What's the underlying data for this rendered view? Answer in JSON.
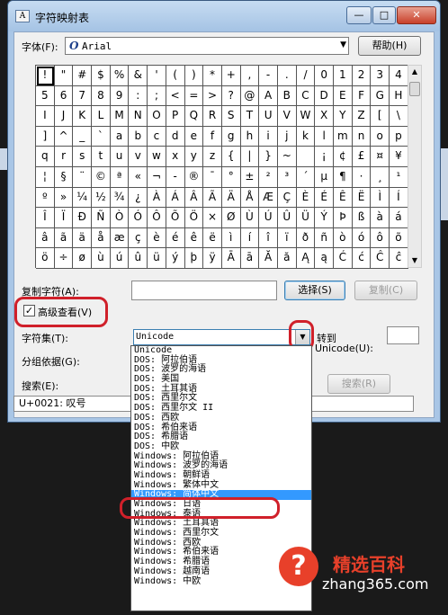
{
  "window": {
    "title": "字符映射表",
    "minimize": "—",
    "maximize": "□",
    "close": "✕",
    "app_icon": "A"
  },
  "font_row": {
    "label": "字体(F):",
    "value": "Arial",
    "icon_glyph": "O",
    "help_button": "帮助(H)"
  },
  "grid": {
    "rows": [
      [
        "!",
        "\"",
        "#",
        "$",
        "%",
        "&",
        "'",
        "(",
        ")",
        "*",
        "+",
        ",",
        "-",
        ".",
        "/",
        "0",
        "1",
        "2",
        "3",
        "4"
      ],
      [
        "5",
        "6",
        "7",
        "8",
        "9",
        ":",
        ";",
        "<",
        "=",
        ">",
        "?",
        "@",
        "A",
        "B",
        "C",
        "D",
        "E",
        "F",
        "G",
        "H"
      ],
      [
        "I",
        "J",
        "K",
        "L",
        "M",
        "N",
        "O",
        "P",
        "Q",
        "R",
        "S",
        "T",
        "U",
        "V",
        "W",
        "X",
        "Y",
        "Z",
        "[",
        "\\"
      ],
      [
        "]",
        "^",
        "_",
        "`",
        "a",
        "b",
        "c",
        "d",
        "e",
        "f",
        "g",
        "h",
        "i",
        "j",
        "k",
        "l",
        "m",
        "n",
        "o",
        "p"
      ],
      [
        "q",
        "r",
        "s",
        "t",
        "u",
        "v",
        "w",
        "x",
        "y",
        "z",
        "{",
        "|",
        "}",
        "~",
        "",
        "¡",
        "¢",
        "£",
        "¤",
        "¥"
      ],
      [
        "¦",
        "§",
        "¨",
        "©",
        "ª",
        "«",
        "¬",
        "-",
        "®",
        "¯",
        "°",
        "±",
        "²",
        "³",
        "´",
        "µ",
        "¶",
        "·",
        "¸",
        "¹"
      ],
      [
        "º",
        "»",
        "¼",
        "½",
        "¾",
        "¿",
        "À",
        "Á",
        "Â",
        "Ã",
        "Ä",
        "Å",
        "Æ",
        "Ç",
        "È",
        "É",
        "Ê",
        "Ë",
        "Ì",
        "Í"
      ],
      [
        "Î",
        "Ï",
        "Ð",
        "Ñ",
        "Ò",
        "Ó",
        "Ô",
        "Õ",
        "Ö",
        "×",
        "Ø",
        "Ù",
        "Ú",
        "Û",
        "Ü",
        "Ý",
        "Þ",
        "ß",
        "à",
        "á"
      ],
      [
        "â",
        "ã",
        "ä",
        "å",
        "æ",
        "ç",
        "è",
        "é",
        "ê",
        "ë",
        "ì",
        "í",
        "î",
        "ï",
        "ð",
        "ñ",
        "ò",
        "ó",
        "ô",
        "õ"
      ],
      [
        "ö",
        "÷",
        "ø",
        "ù",
        "ú",
        "û",
        "ü",
        "ý",
        "þ",
        "ÿ",
        "Ā",
        "ā",
        "Ă",
        "ă",
        "Ą",
        "ą",
        "Ć",
        "ć",
        "Ĉ",
        "ĉ"
      ]
    ]
  },
  "copy_row": {
    "label": "复制字符(A):",
    "value": "",
    "select_button": "选择(S)",
    "copy_button": "复制(C)"
  },
  "advanced": {
    "label": "高级查看(V)",
    "checked": "✓"
  },
  "charset": {
    "label": "字符集(T):",
    "value": "Unicode",
    "goto_label": "转到",
    "goto_unicode_label": "Unicode(U):"
  },
  "group_by": {
    "label": "分组依据(G):"
  },
  "search": {
    "label": "搜索(E):",
    "button": "搜索(R)"
  },
  "status": "U+0021: 叹号",
  "dropdown_items": [
    "Unicode",
    "DOS: 阿拉伯语",
    "DOS: 波罗的海语",
    "DOS: 美国",
    "DOS: 土耳其语",
    "DOS: 西里尔文",
    "DOS: 西里尔文 II",
    "DOS: 西欧",
    "DOS: 希伯来语",
    "DOS: 希腊语",
    "DOS: 中欧",
    "Windows: 阿拉伯语",
    "Windows: 波罗的海语",
    "Windows: 朝鲜语",
    "Windows: 繁体中文",
    "Windows: 简体中文",
    "Windows: 日语",
    "Windows: 泰语",
    "Windows: 土耳其语",
    "Windows: 西里尔文",
    "Windows: 西欧",
    "Windows: 希伯来语",
    "Windows: 希腊语",
    "Windows: 越南语",
    "Windows: 中欧"
  ],
  "highlighted_item": "Windows: 简体中文",
  "watermark": {
    "icon": "?",
    "brand": "精选百科",
    "url": "zhang365.com"
  },
  "colors": {
    "highlight": "#3399ff",
    "annotation_ring": "#d0202a"
  }
}
